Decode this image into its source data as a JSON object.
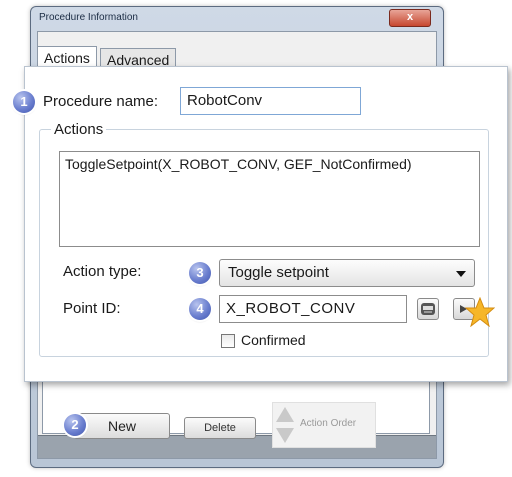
{
  "window": {
    "title": "Procedure Information",
    "close_glyph": "x"
  },
  "tabs": [
    {
      "label": "Actions",
      "active": true
    },
    {
      "label": "Advanced",
      "active": false
    }
  ],
  "procedure": {
    "name_label": "Procedure name:",
    "name_value": "RobotConv"
  },
  "actions_group": {
    "title": "Actions",
    "list_items": [
      "ToggleSetpoint(X_ROBOT_CONV, GEF_NotConfirmed)"
    ]
  },
  "action_type": {
    "label": "Action type:",
    "selected": "Toggle setpoint"
  },
  "point_id": {
    "label": "Point ID:",
    "value": "X_ROBOT_CONV",
    "browse_icon": "browse-points-icon",
    "star_icon": "highlight-star-icon"
  },
  "confirmed": {
    "label": "Confirmed",
    "checked": false
  },
  "footer": {
    "new_label": "New",
    "delete_label": "Delete",
    "order_label": "Action Order"
  },
  "badges": [
    "1",
    "2",
    "3",
    "4"
  ],
  "colors": {
    "badge": "#5a6fc4",
    "input_border": "#7fa7d6",
    "star": "#f6b628"
  }
}
